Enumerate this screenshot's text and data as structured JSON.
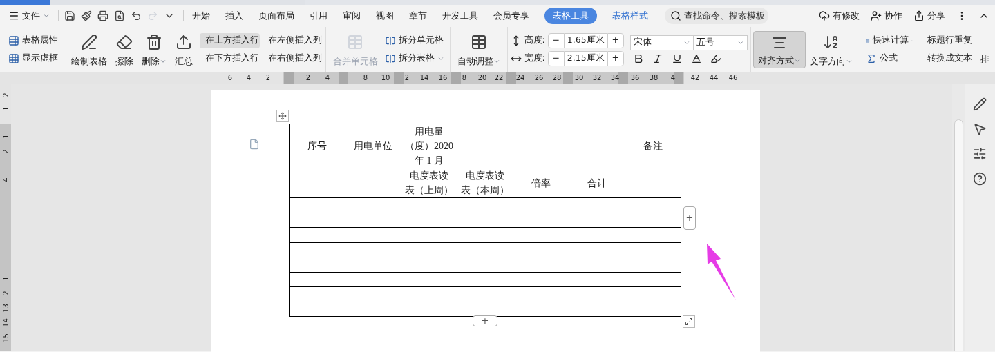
{
  "menu": {
    "file": "文件",
    "tabs": [
      {
        "label": "开始",
        "selected": false
      },
      {
        "label": "插入",
        "selected": false
      },
      {
        "label": "页面布局",
        "selected": false
      },
      {
        "label": "引用",
        "selected": false
      },
      {
        "label": "审阅",
        "selected": false
      },
      {
        "label": "视图",
        "selected": false
      },
      {
        "label": "章节",
        "selected": false
      },
      {
        "label": "开发工具",
        "selected": false
      },
      {
        "label": "会员专享",
        "selected": false
      },
      {
        "label": "表格工具",
        "selected": true
      },
      {
        "label": "表格样式",
        "selected": false
      }
    ],
    "search": {
      "placeholder": "查找命令、搜索模板"
    },
    "right": [
      "有修改",
      "协作",
      "分享"
    ]
  },
  "ribbon": {
    "table_props": [
      "表格属性",
      "显示虚框"
    ],
    "draw_tools": [
      {
        "label": "绘制表格",
        "dropdown": false
      },
      {
        "label": "擦除",
        "dropdown": false
      },
      {
        "label": "删除",
        "dropdown": true
      },
      {
        "label": "汇总",
        "dropdown": false
      }
    ],
    "insert": [
      {
        "label": "在上方插入行",
        "selected": true
      },
      {
        "label": "在下方插入行",
        "selected": false
      },
      {
        "label": "在左侧插入列",
        "selected": false
      },
      {
        "label": "在右侧插入列",
        "selected": false
      }
    ],
    "merge": {
      "label": "合并单元格",
      "disabled": true
    },
    "split": [
      {
        "label": "拆分单元格",
        "dropdown": false
      },
      {
        "label": "拆分表格",
        "dropdown": true
      }
    ],
    "autofit": {
      "label": "自动调整",
      "dropdown": true
    },
    "size": [
      {
        "label": "高度:",
        "value": "1.65厘米",
        "minus": "−",
        "plus": "+"
      },
      {
        "label": "宽度:",
        "value": "2.15厘米",
        "minus": "−",
        "plus": "+"
      }
    ],
    "font": {
      "family": "宋体",
      "size": "五号"
    },
    "align": {
      "label": "对齐方式",
      "pressed": true,
      "dropdown": true
    },
    "direction": {
      "label": "文字方向",
      "dropdown": true
    },
    "calc": [
      {
        "label": "快速计算",
        "dropdown": true
      },
      {
        "label": "标题行重复",
        "dropdown": false
      }
    ],
    "calc2": [
      {
        "label": "公式"
      },
      {
        "label": "转换成文本"
      }
    ],
    "cut_label": "排"
  },
  "ruler": {
    "h_labels": [
      "6",
      "4",
      "2",
      "2",
      "4",
      "8",
      "10",
      "2",
      "14",
      "16",
      "8",
      "20",
      "22",
      "24",
      "26",
      "28",
      "30",
      "32",
      "34",
      "36",
      "38",
      "4",
      "42",
      "44",
      "46"
    ],
    "v_labels": [
      "2",
      "1",
      "1",
      "2",
      "4",
      "1",
      "2",
      "13",
      "14",
      "15"
    ]
  },
  "table": {
    "rows": [
      [
        [
          "序号"
        ],
        [
          "用电单位"
        ],
        [
          "用电量",
          "（度）2020",
          "年 1 月"
        ],
        null,
        null,
        null,
        [
          "备注"
        ]
      ],
      [
        null,
        null,
        [
          "电度表读",
          "表（上周）"
        ],
        [
          "电度表读",
          "表（本周）"
        ],
        [
          "倍率"
        ],
        [
          "合计"
        ],
        null
      ],
      [
        null,
        null,
        null,
        null,
        null,
        null,
        null
      ],
      [
        null,
        null,
        null,
        null,
        null,
        null,
        null
      ],
      [
        null,
        null,
        null,
        null,
        null,
        null,
        null
      ],
      [
        null,
        null,
        null,
        null,
        null,
        null,
        null
      ],
      [
        null,
        null,
        null,
        null,
        null,
        null,
        null
      ],
      [
        null,
        null,
        null,
        null,
        null,
        null,
        null
      ],
      [
        null,
        null,
        null,
        null,
        null,
        null,
        null
      ],
      [
        null,
        null,
        null,
        null,
        null,
        null,
        null
      ]
    ],
    "add_column": "+",
    "add_row": "+"
  }
}
